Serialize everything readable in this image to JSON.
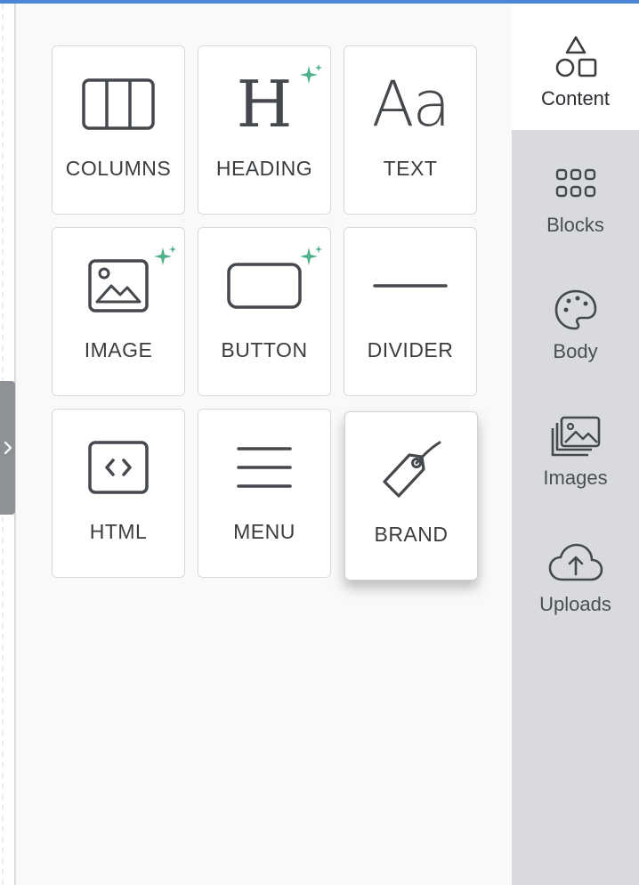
{
  "tools": [
    {
      "label": "COLUMNS",
      "icon": "columns-icon",
      "new": false
    },
    {
      "label": "HEADING",
      "icon": "heading-icon",
      "new": true
    },
    {
      "label": "TEXT",
      "icon": "text-icon",
      "new": false
    },
    {
      "label": "IMAGE",
      "icon": "image-icon",
      "new": true
    },
    {
      "label": "BUTTON",
      "icon": "button-icon",
      "new": true
    },
    {
      "label": "DIVIDER",
      "icon": "divider-icon",
      "new": false
    },
    {
      "label": "HTML",
      "icon": "html-icon",
      "new": false
    },
    {
      "label": "MENU",
      "icon": "menu-icon",
      "new": false
    },
    {
      "label": "BRAND",
      "icon": "tag-icon",
      "new": false
    }
  ],
  "heading_glyph": "H",
  "text_glyph": "Aa",
  "sidebar": {
    "items": [
      {
        "label": "Content",
        "icon": "shapes-icon",
        "active": true
      },
      {
        "label": "Blocks",
        "icon": "grid-dots-icon",
        "active": false
      },
      {
        "label": "Body",
        "icon": "palette-icon",
        "active": false
      },
      {
        "label": "Images",
        "icon": "images-icon",
        "active": false
      },
      {
        "label": "Uploads",
        "icon": "cloud-upload-icon",
        "active": false
      }
    ]
  },
  "colors": {
    "accent": "#4a86d8",
    "sparkle": "#4fb38a",
    "icon": "#45494d"
  }
}
